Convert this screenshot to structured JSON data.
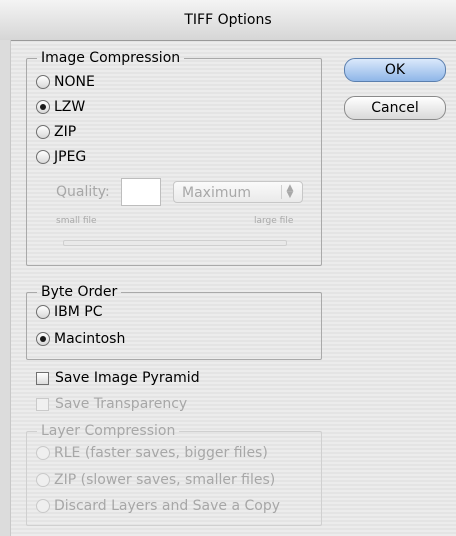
{
  "window": {
    "title": "TIFF Options"
  },
  "buttons": {
    "ok": "OK",
    "cancel": "Cancel"
  },
  "image_compression": {
    "legend": "Image Compression",
    "options": [
      "NONE",
      "LZW",
      "ZIP",
      "JPEG"
    ],
    "selected": "LZW",
    "quality_label": "Quality:",
    "quality_value": "",
    "quality_select": "Maximum",
    "small_file": "small file",
    "large_file": "large file"
  },
  "byte_order": {
    "legend": "Byte Order",
    "options": [
      "IBM PC",
      "Macintosh"
    ],
    "selected": "Macintosh"
  },
  "checkboxes": {
    "save_image_pyramid": "Save Image Pyramid",
    "save_transparency": "Save Transparency"
  },
  "layer_compression": {
    "legend": "Layer Compression",
    "options": [
      "RLE (faster saves, bigger files)",
      "ZIP (slower saves, smaller files)",
      "Discard Layers and Save a Copy"
    ]
  }
}
